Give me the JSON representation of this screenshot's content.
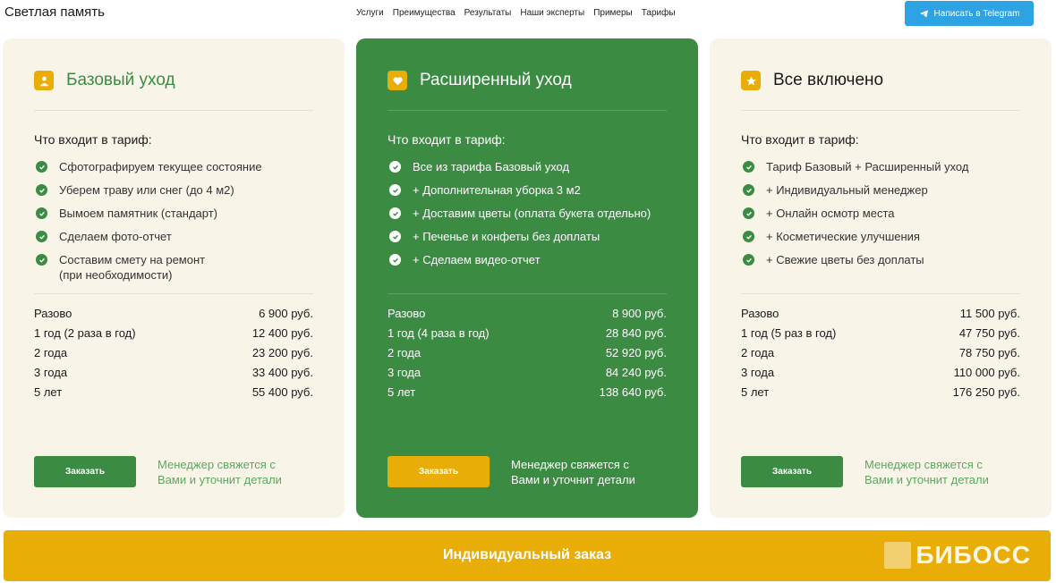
{
  "header": {
    "logo": "Светлая память",
    "nav": [
      "Услуги",
      "Преимущества",
      "Результаты",
      "Наши эксперты",
      "Примеры",
      "Тарифы"
    ],
    "telegram_button": "Написать в Telegram"
  },
  "plans": [
    {
      "title": "Базовый уход",
      "icon": "user-icon",
      "includes_label": "Что входит в тариф:",
      "features": [
        "Сфотографируем текущее состояние",
        "Уберем траву или снег (до 4 м2)",
        "Вымоем памятник (стандарт)",
        "Сделаем фото-отчет",
        "Составим смету на ремонт\n(при необходимости)"
      ],
      "prices": [
        {
          "period": "Разово",
          "price": "6 900 руб."
        },
        {
          "period": "1 год (2 раза в год)",
          "price": "12 400 руб."
        },
        {
          "period": "2 года",
          "price": "23 200 руб."
        },
        {
          "period": "3 года",
          "price": "33 400 руб."
        },
        {
          "period": "5 лет",
          "price": "55 400 руб."
        }
      ],
      "order_button": "Заказать",
      "order_note": "Менеджер свяжется с\nВами и уточнит детали"
    },
    {
      "title": "Расширенный уход",
      "icon": "heart-icon",
      "includes_label": "Что входит в тариф:",
      "features": [
        "Все из тарифа Базовый уход",
        "+ Дополнительная уборка 3 м2",
        "+ Доставим цветы (оплата букета отдельно)",
        "+ Печенье и конфеты без доплаты",
        "+ Сделаем видео-отчет"
      ],
      "prices": [
        {
          "period": "Разово",
          "price": "8 900 руб."
        },
        {
          "period": "1 год (4 раза в год)",
          "price": "28 840 руб."
        },
        {
          "period": "2 года",
          "price": "52 920 руб."
        },
        {
          "period": "3 года",
          "price": "84 240 руб."
        },
        {
          "period": "5 лет",
          "price": "138 640 руб."
        }
      ],
      "order_button": "Заказать",
      "order_note": "Менеджер свяжется с\nВами и уточнит детали"
    },
    {
      "title": "Все включено",
      "icon": "star-icon",
      "includes_label": "Что входит в тариф:",
      "features": [
        "Тариф Базовый + Расширенный уход",
        "+ Индивидуальный менеджер",
        "+ Онлайн осмотр места",
        "+ Косметические улучшения",
        "+ Свежие цветы без доплаты"
      ],
      "prices": [
        {
          "period": "Разово",
          "price": "11 500 руб."
        },
        {
          "period": "1 год (5 раз в год)",
          "price": "47 750 руб."
        },
        {
          "period": "2 года",
          "price": "78 750 руб."
        },
        {
          "period": "3 года",
          "price": "110 000 руб."
        },
        {
          "period": "5 лет",
          "price": "176 250 руб."
        }
      ],
      "order_button": "Заказать",
      "order_note": "Менеджер свяжется с\nВами и уточнит детали"
    }
  ],
  "bottom": {
    "label": "Индивидуальный заказ",
    "brand": "БИБОСС"
  },
  "colors": {
    "green": "#3c8b43",
    "accent": "#e9ad08",
    "card_bg": "#f8f5e8",
    "telegram": "#2ea3e3"
  }
}
